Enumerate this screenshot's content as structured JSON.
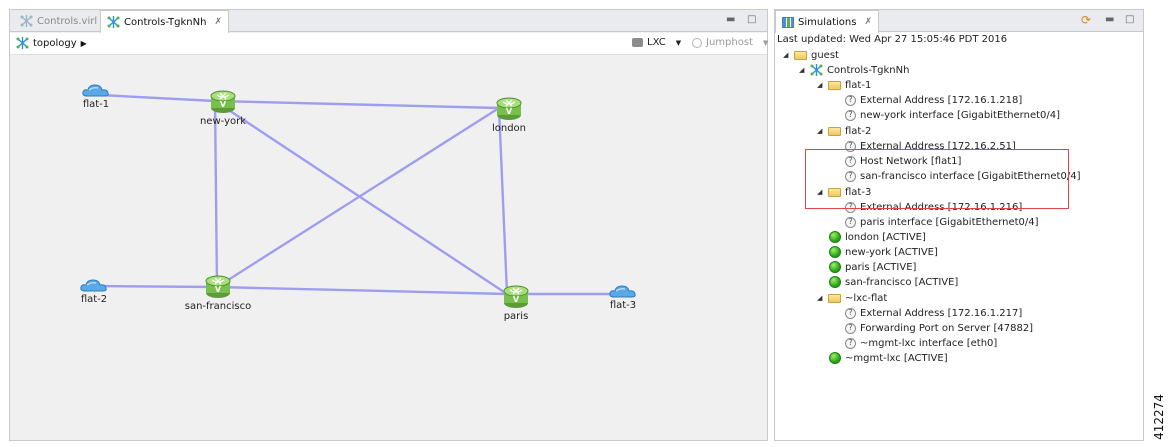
{
  "editor": {
    "tabs": [
      {
        "label": "Controls.virl",
        "active": false
      },
      {
        "label": "Controls-TgknNh",
        "active": true,
        "close": "✗"
      }
    ],
    "toolbar": {
      "topology_label": "topology",
      "lxc_label": "LXC",
      "jumphost_label": "Jumphost"
    },
    "nodes": {
      "flat1": "flat-1",
      "newyork": "new-york",
      "london": "london",
      "flat2": "flat-2",
      "sanfrancisco": "san-francisco",
      "paris": "paris",
      "flat3": "flat-3"
    },
    "link_color": "#9f9df0"
  },
  "simulations": {
    "tab_label": "Simulations",
    "tab_close": "✗",
    "last_updated": "Last updated: Wed Apr 27 15:05:46 PDT 2016",
    "tree": {
      "guest": "guest",
      "sim": "Controls-TgknNh",
      "flat1": "flat-1",
      "flat1_ext": "External Address  [172.16.1.218]",
      "flat1_ny": "new-york interface  [GigabitEthernet0/4]",
      "flat2": "flat-2",
      "flat2_ext": "External Address  [172.16.2.51]",
      "flat2_host": "Host Network  [flat1]",
      "flat2_sf": "san-francisco interface  [GigabitEthernet0/4]",
      "flat3": "flat-3",
      "flat3_ext": "External Address  [172.16.1.216]",
      "flat3_paris": "paris interface  [GigabitEthernet0/4]",
      "london": "london  [ACTIVE]",
      "newyork": "new-york  [ACTIVE]",
      "paris": "paris  [ACTIVE]",
      "sanfrancisco": "san-francisco  [ACTIVE]",
      "lxcflat": "~lxc-flat",
      "lxc_ext": "External Address  [172.16.1.217]",
      "lxc_fwd": "Forwarding Port on Server  [47882]",
      "lxc_mgmt": "~mgmt-lxc interface  [eth0]",
      "mgmtlxc": "~mgmt-lxc  [ACTIVE]"
    },
    "highlight_color": "#e04848"
  },
  "figure_id": "412274"
}
